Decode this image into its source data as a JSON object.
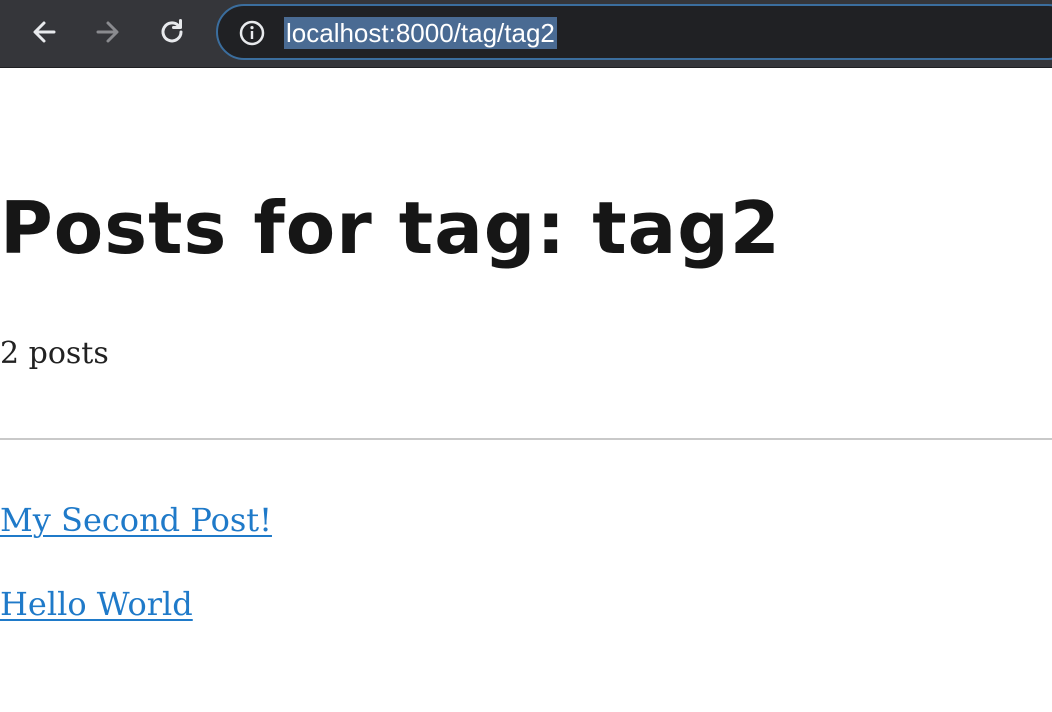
{
  "browser": {
    "url": "localhost:8000/tag/tag2",
    "icons": {
      "back": "back-arrow-icon",
      "forward": "forward-arrow-icon",
      "reload": "reload-icon",
      "site_info": "info-icon"
    },
    "colors": {
      "toolbar_bg": "#35363a",
      "omnibox_bg": "#202124",
      "omnibox_border": "#3b6e9e",
      "url_selection": "#4a6b93"
    }
  },
  "page": {
    "title": "Posts for tag: tag2",
    "post_count": "2 posts",
    "posts": [
      {
        "title": "My Second Post!"
      },
      {
        "title": "Hello World"
      }
    ],
    "colors": {
      "link": "#1f7ac9",
      "heading": "#161616"
    }
  }
}
